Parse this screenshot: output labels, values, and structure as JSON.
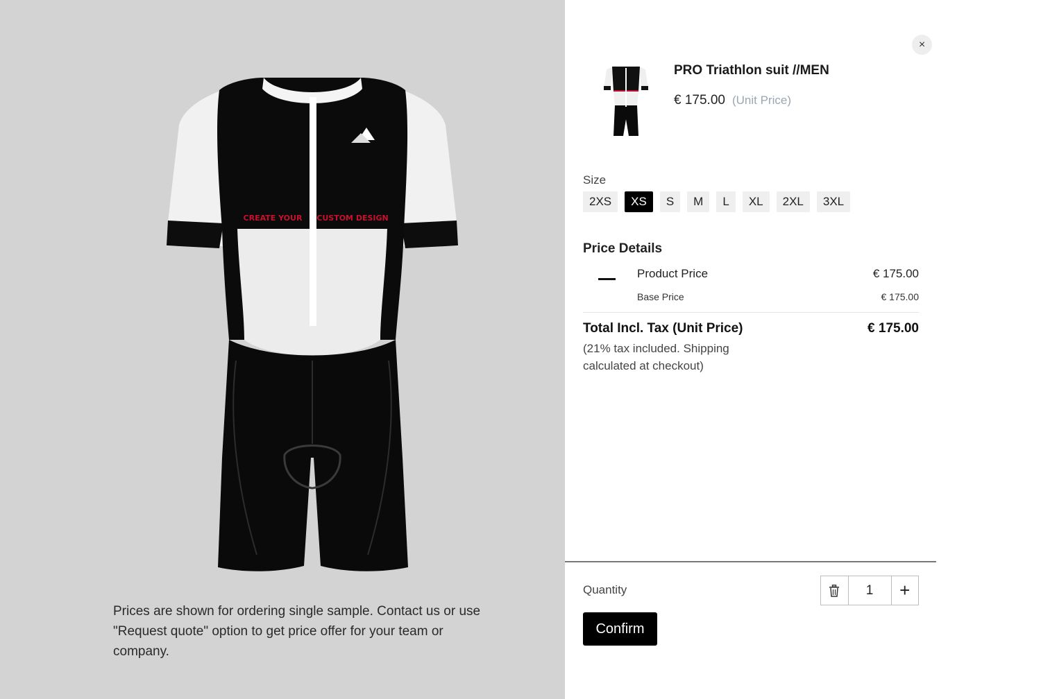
{
  "preview": {
    "image_icon": "triathlon-suit-image",
    "chest_text_left": "CREATE YOUR",
    "chest_text_right": "CUSTOM DESIGN",
    "disclaimer": "Prices are shown for ordering single sample. Contact us or use \"Request quote\" option to get price offer for your team or company."
  },
  "panel": {
    "close_icon": "close-icon",
    "close_glyph": "×",
    "product_title": "PRO Triathlon suit //MEN",
    "unit_price": "€ 175.00",
    "unit_price_label": "(Unit Price)"
  },
  "size": {
    "label": "Size",
    "options": [
      "2XS",
      "XS",
      "S",
      "M",
      "L",
      "XL",
      "2XL",
      "3XL"
    ],
    "selected": "XS"
  },
  "price_details": {
    "title": "Price Details",
    "product_price_label": "Product Price",
    "product_price_value": "€ 175.00",
    "base_price_label": "Base Price",
    "base_price_value": "€ 175.00",
    "total_label": "Total Incl. Tax (Unit Price)",
    "total_value": "€ 175.00",
    "tax_note": "(21% tax included. Shipping calculated at checkout)"
  },
  "footer": {
    "quantity_label": "Quantity",
    "quantity_value": "1",
    "plus_glyph": "+",
    "trash_icon": "trash-icon",
    "plus_icon": "plus-icon",
    "confirm_label": "Confirm"
  },
  "colors": {
    "preview_bg": "#d3d3d3",
    "accent": "#000000",
    "chip_bg": "#efefef",
    "design_text": "#c8102e"
  }
}
